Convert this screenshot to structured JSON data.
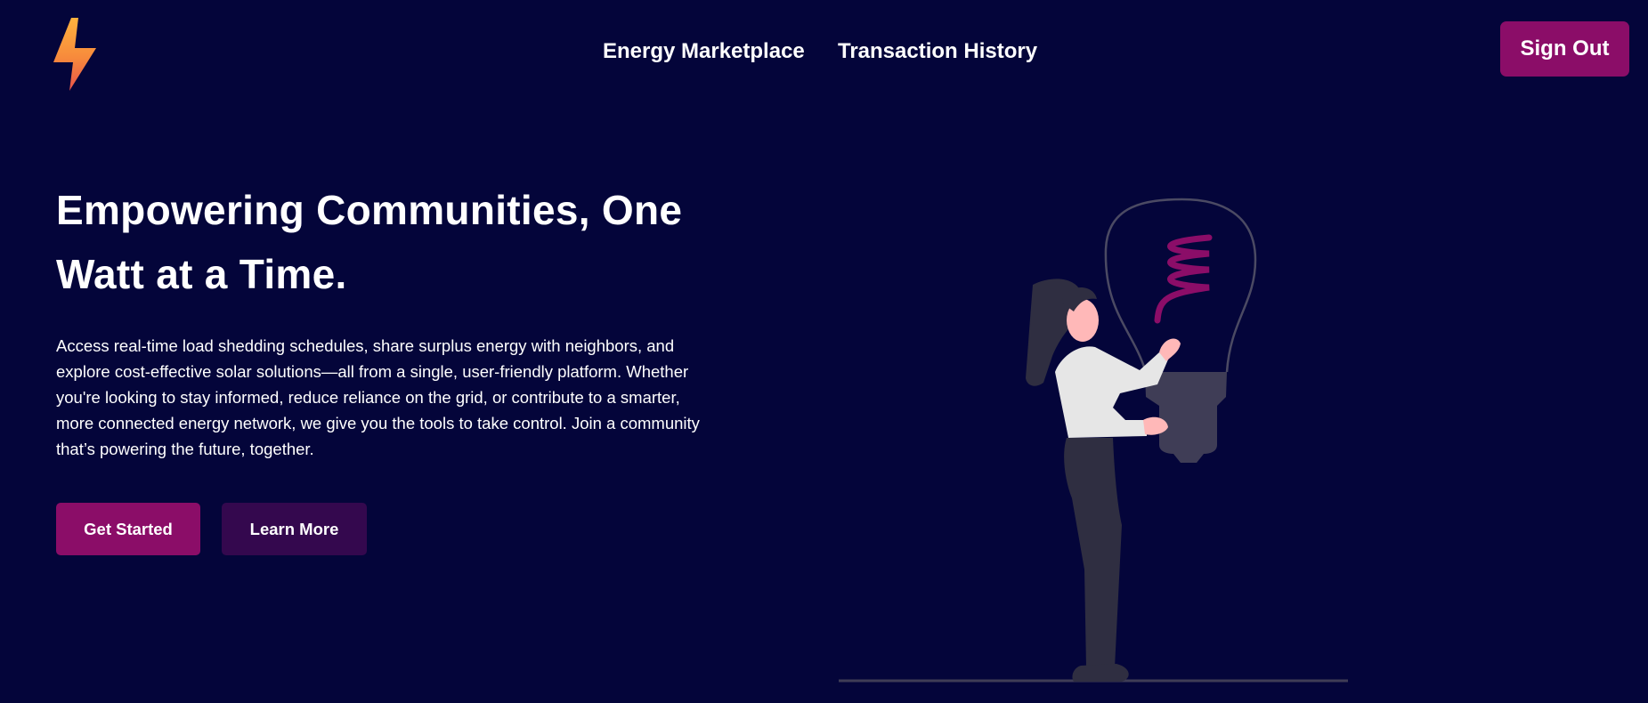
{
  "header": {
    "logo_icon": "lightning-bolt-icon",
    "nav": [
      {
        "label": "Energy Marketplace"
      },
      {
        "label": "Transaction History"
      }
    ],
    "sign_out_label": "Sign Out"
  },
  "hero": {
    "title_line1": "Empowering Communities, One",
    "title_line2": "Watt at a Time.",
    "description_lines": [
      "Access real-time load shedding schedules, share surplus energy with neighbors, and",
      "explore cost-effective solar solutions—all from a single, user-friendly platform. Whether",
      "you're looking to stay informed, reduce reliance on the grid, or contribute to a smarter,",
      "more connected energy network, we give you the tools to take control. Join a community",
      "that’s powering the future, together."
    ],
    "primary_button": "Get Started",
    "secondary_button": "Learn More"
  },
  "illustration": {
    "icon": "woman-holding-lightbulb-illustration"
  },
  "colors": {
    "background": "#04053a",
    "accent": "#8b0d68",
    "secondary_button": "#34084e",
    "text": "#ffffff"
  }
}
